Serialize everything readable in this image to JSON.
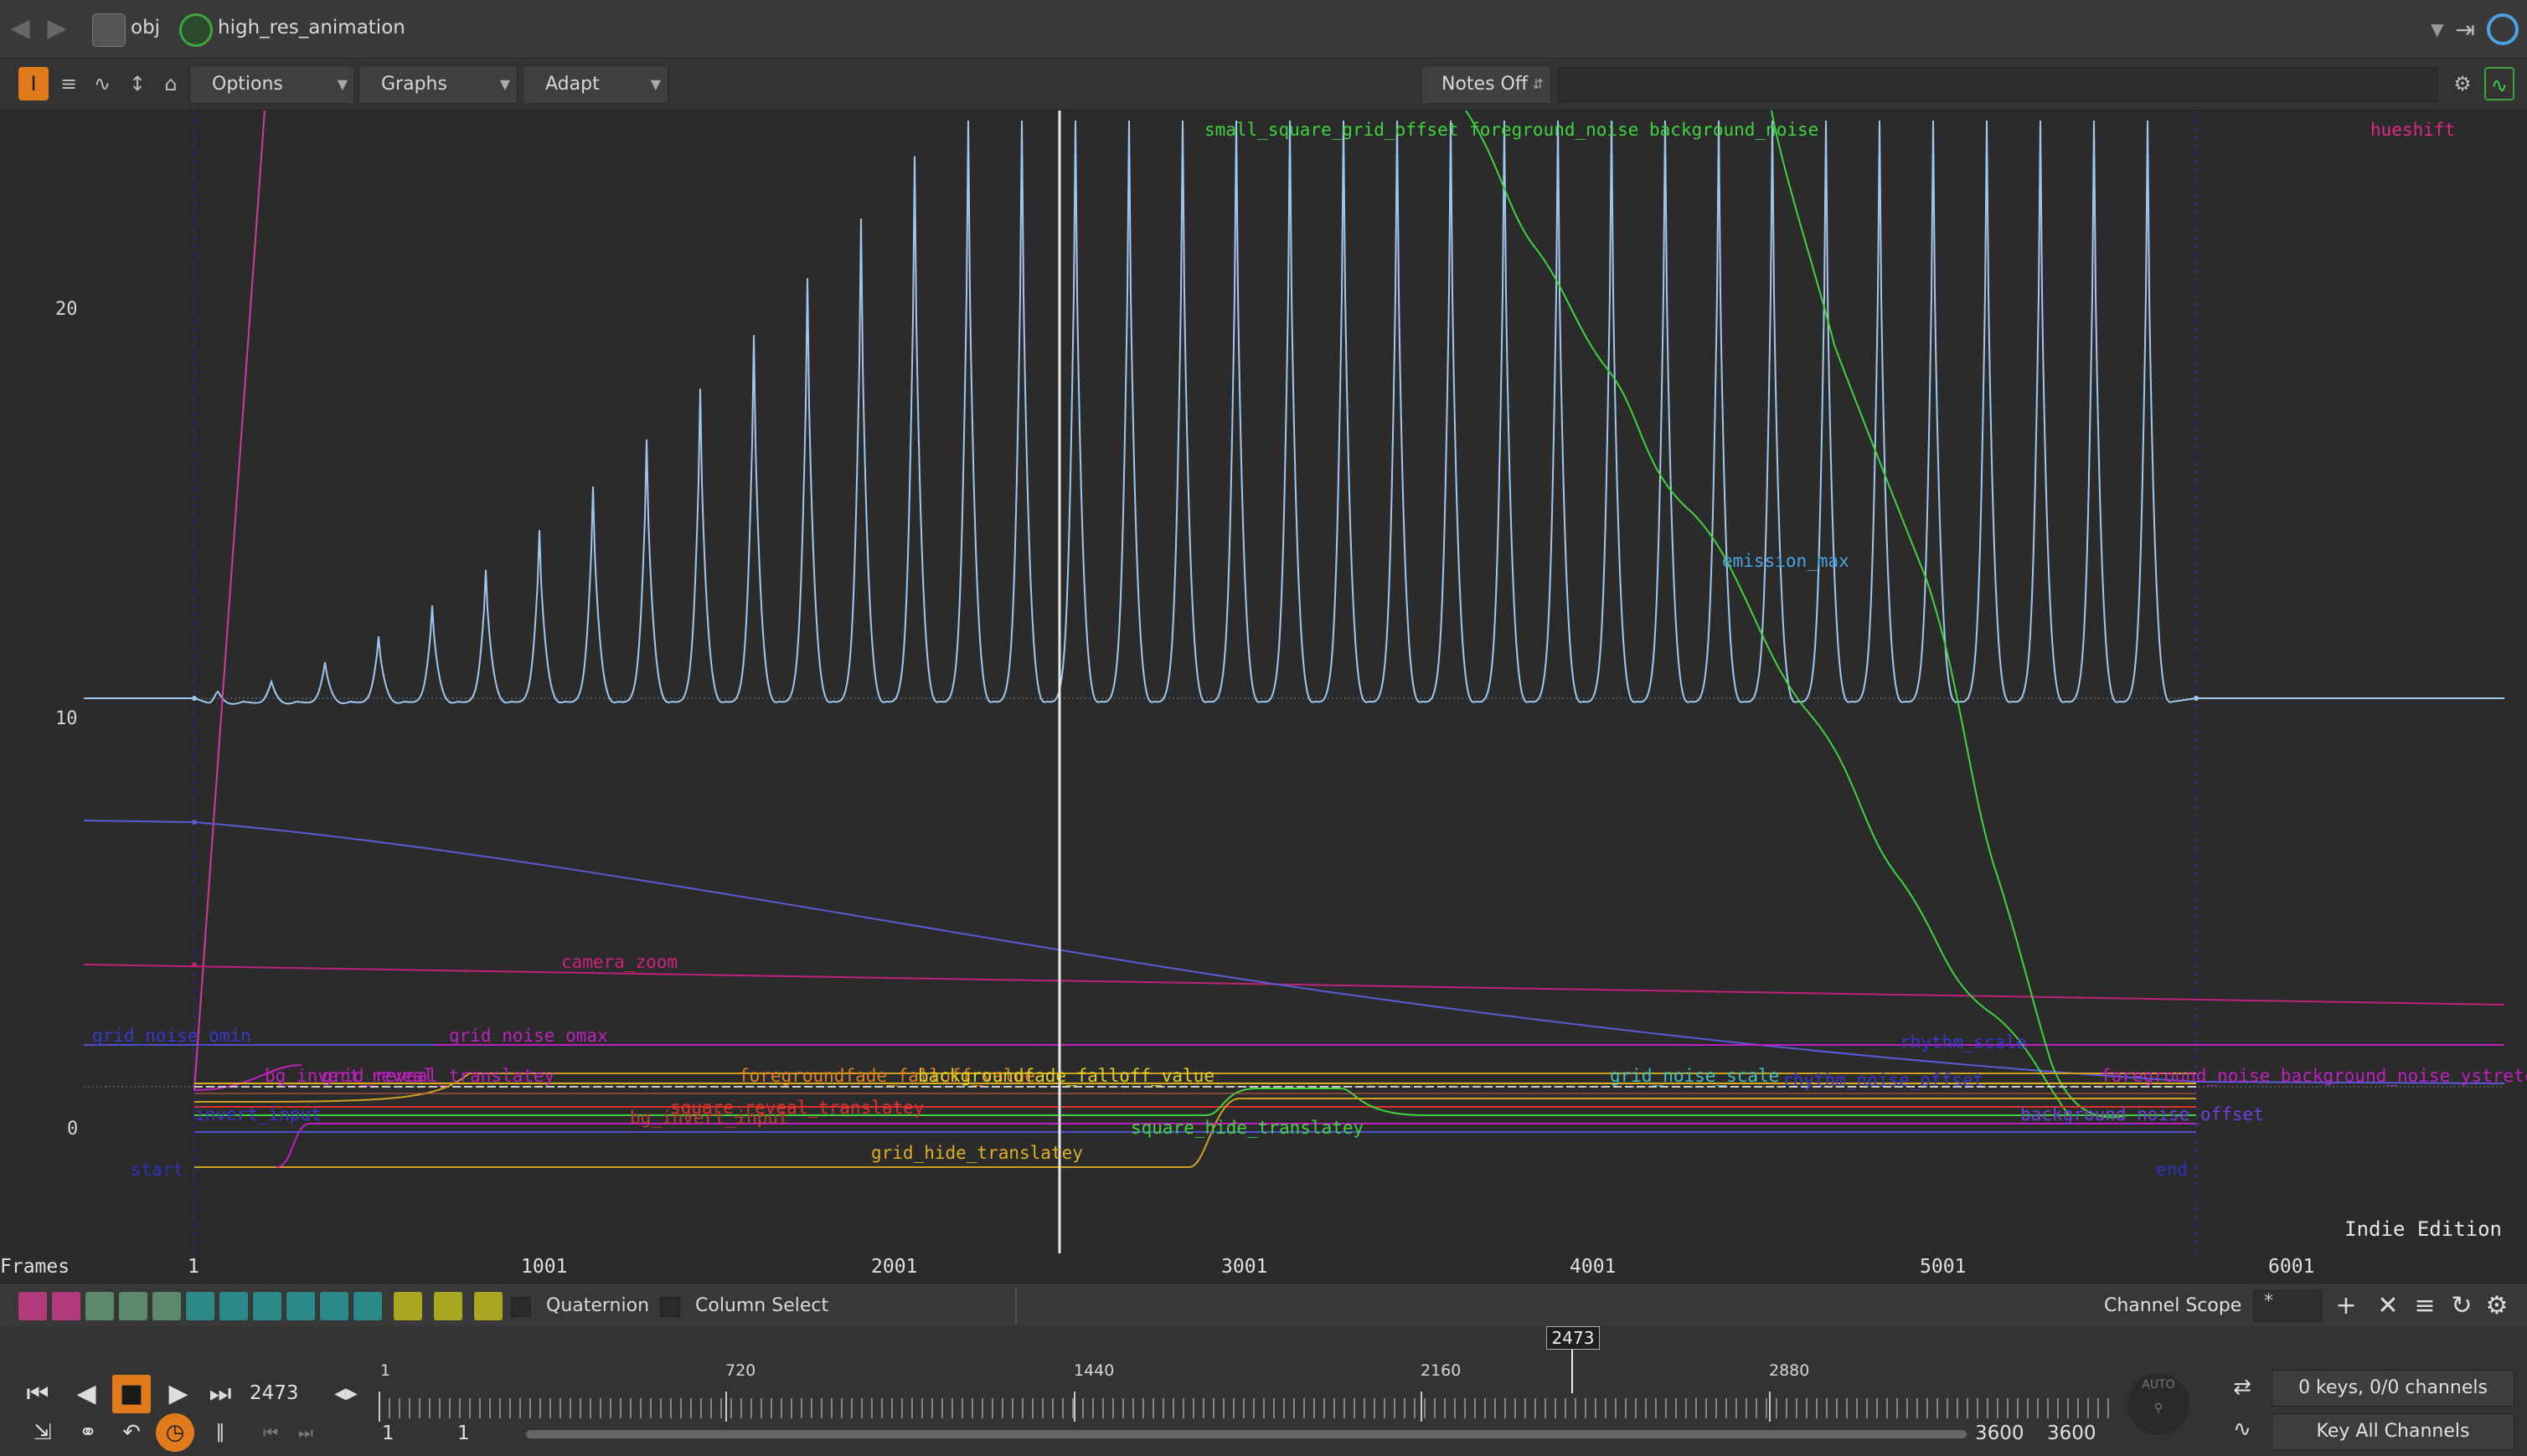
{
  "pathbar": {
    "crumb1": "obj",
    "crumb2": "high_res_animation"
  },
  "toolbar": {
    "options_label": "Options",
    "graphs_label": "Graphs",
    "adapt_label": "Adapt",
    "notes_label": "Notes Off"
  },
  "graph": {
    "y_ticks": [
      "20",
      "10",
      "0"
    ],
    "watermark": "Indie Edition",
    "channel_labels": {
      "hueshift": "hueshift",
      "emission_max": "emission_max",
      "camera_zoom": "camera_zoom",
      "grid_noise_omin": "grid_noise_omin",
      "grid_noise_omax": "grid_noise_omax",
      "bg_invert_reveal": "bg_invert_reveal",
      "grid_reveal_translatey": "grid_reveal_translatey",
      "foregroundfade_falloff": "foregroundfade_falloff_value",
      "backgroundfade_falloff": "backgroundfade_falloff_value",
      "grid_noise_scale": "grid_noise_scale",
      "rhythm_noise_offset": "rhythm_noise_offset",
      "rhythm_scale": "rhythm_scale",
      "square_reveal_translatey": "square_reveal_translatey",
      "bg_invert_input": "bg_invert_input",
      "invert_input": "invert_input",
      "grid_hide_translatey": "grid_hide_translatey",
      "square_hide_translatey": "square_hide_translatey",
      "start": "start",
      "end": "end",
      "top_overlap": "small_square_grid_offset foreground_noise background_noise",
      "right_overlap": "foreground_noise background_noise ystretch",
      "right_overlap2": "background_noise_offset"
    }
  },
  "ruler": {
    "label": "Frames",
    "ticks": [
      "1",
      "1001",
      "2001",
      "3001",
      "4001",
      "5001",
      "6001"
    ]
  },
  "chanbar": {
    "quaternion_label": "Quaternion",
    "column_select_label": "Column Select",
    "scope_label": "Channel Scope",
    "scope_value": "*"
  },
  "playbar": {
    "current_frame": "2473",
    "timeline_ticks": [
      "1",
      "720",
      "1440",
      "2160",
      "2880"
    ],
    "range_start": "1",
    "range_step": "1",
    "range_end": "3600",
    "range_end2": "3600",
    "keys_status": "0 keys, 0/0 channels",
    "key_all": "Key All Channels",
    "auto_label": "AUTO"
  },
  "colors": {
    "accent": "#e07b1b",
    "emission_curve": "#9fc8ee",
    "green_curve": "#3fd43f",
    "magenta_curve": "#d03aa0",
    "blue_curve": "#5a5ad6"
  }
}
